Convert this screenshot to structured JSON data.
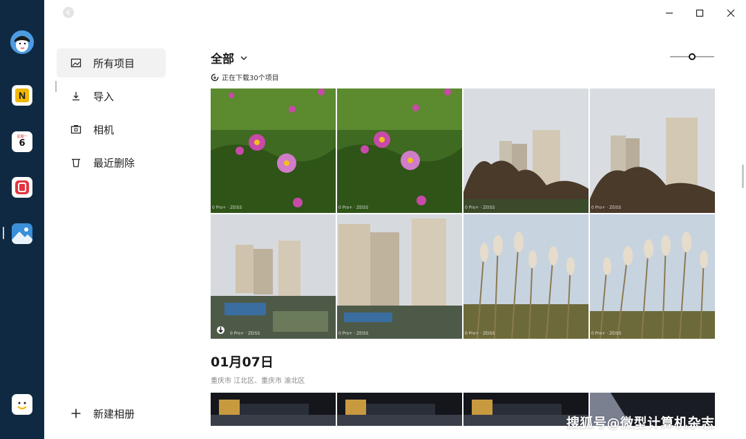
{
  "dock": {
    "apps": [
      {
        "name": "avatar",
        "glyph": ""
      },
      {
        "name": "notes-app",
        "glyph": "N"
      },
      {
        "name": "calendar-app",
        "glyph": "6",
        "top_text": "星期一"
      },
      {
        "name": "red-app",
        "glyph": ""
      },
      {
        "name": "gallery-app",
        "glyph": ""
      },
      {
        "name": "smile-app",
        "glyph": ""
      }
    ]
  },
  "sidebar": {
    "items": [
      {
        "label": "所有项目",
        "icon": "image-icon",
        "active": true
      },
      {
        "label": "导入",
        "icon": "download-icon"
      },
      {
        "label": "相机",
        "icon": "camera-icon"
      },
      {
        "label": "最近删除",
        "icon": "trash-icon"
      }
    ],
    "new_album_label": "新建相册"
  },
  "main": {
    "filter_label": "全部",
    "download_status": "正在下载30个项目",
    "watermark_text": "0 Pro+ · ZEISS",
    "section2": {
      "date": "01月07日",
      "location": "重庆市 江北区、重庆市 渝北区"
    }
  },
  "overlay_watermark": "搜狐号@微型计算机杂志",
  "colors": {
    "dock_bg": "#0f2942",
    "notes_app": "#f2b705",
    "red_app": "#e3343f",
    "gallery_app": "#3a8fd8"
  }
}
